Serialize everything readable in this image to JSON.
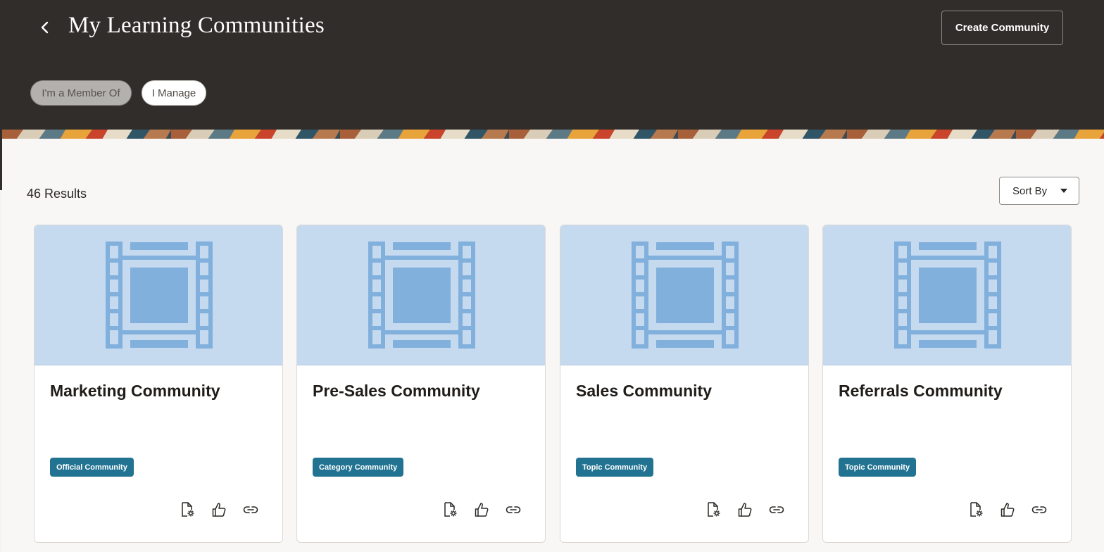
{
  "header": {
    "title": "My Learning Communities",
    "create_label": "Create Community",
    "back_icon": "chevron-left-icon",
    "background_color": "#312d2a"
  },
  "filters": {
    "chips": [
      {
        "label": "I'm a Member Of",
        "selected": true
      },
      {
        "label": "I Manage",
        "selected": false
      }
    ]
  },
  "results": {
    "count_label": "46 Results",
    "sort_label": "Sort By"
  },
  "cards": [
    {
      "title": "Marketing Community",
      "badge": "Official Community",
      "thumbnail_icon": "film-strip-icon"
    },
    {
      "title": "Pre-Sales Community",
      "badge": "Category Community",
      "thumbnail_icon": "film-strip-icon"
    },
    {
      "title": "Sales Community",
      "badge": "Topic Community",
      "thumbnail_icon": "film-strip-icon"
    },
    {
      "title": "Referrals Community",
      "badge": "Topic Community",
      "thumbnail_icon": "film-strip-icon"
    }
  ],
  "card_action_icons": [
    "document-settings-icon",
    "thumbs-up-icon",
    "link-icon"
  ],
  "colors": {
    "badge": "#227392",
    "thumbnail_bg": "#c5d9ef",
    "thumbnail_icon": "#82b0dd"
  }
}
